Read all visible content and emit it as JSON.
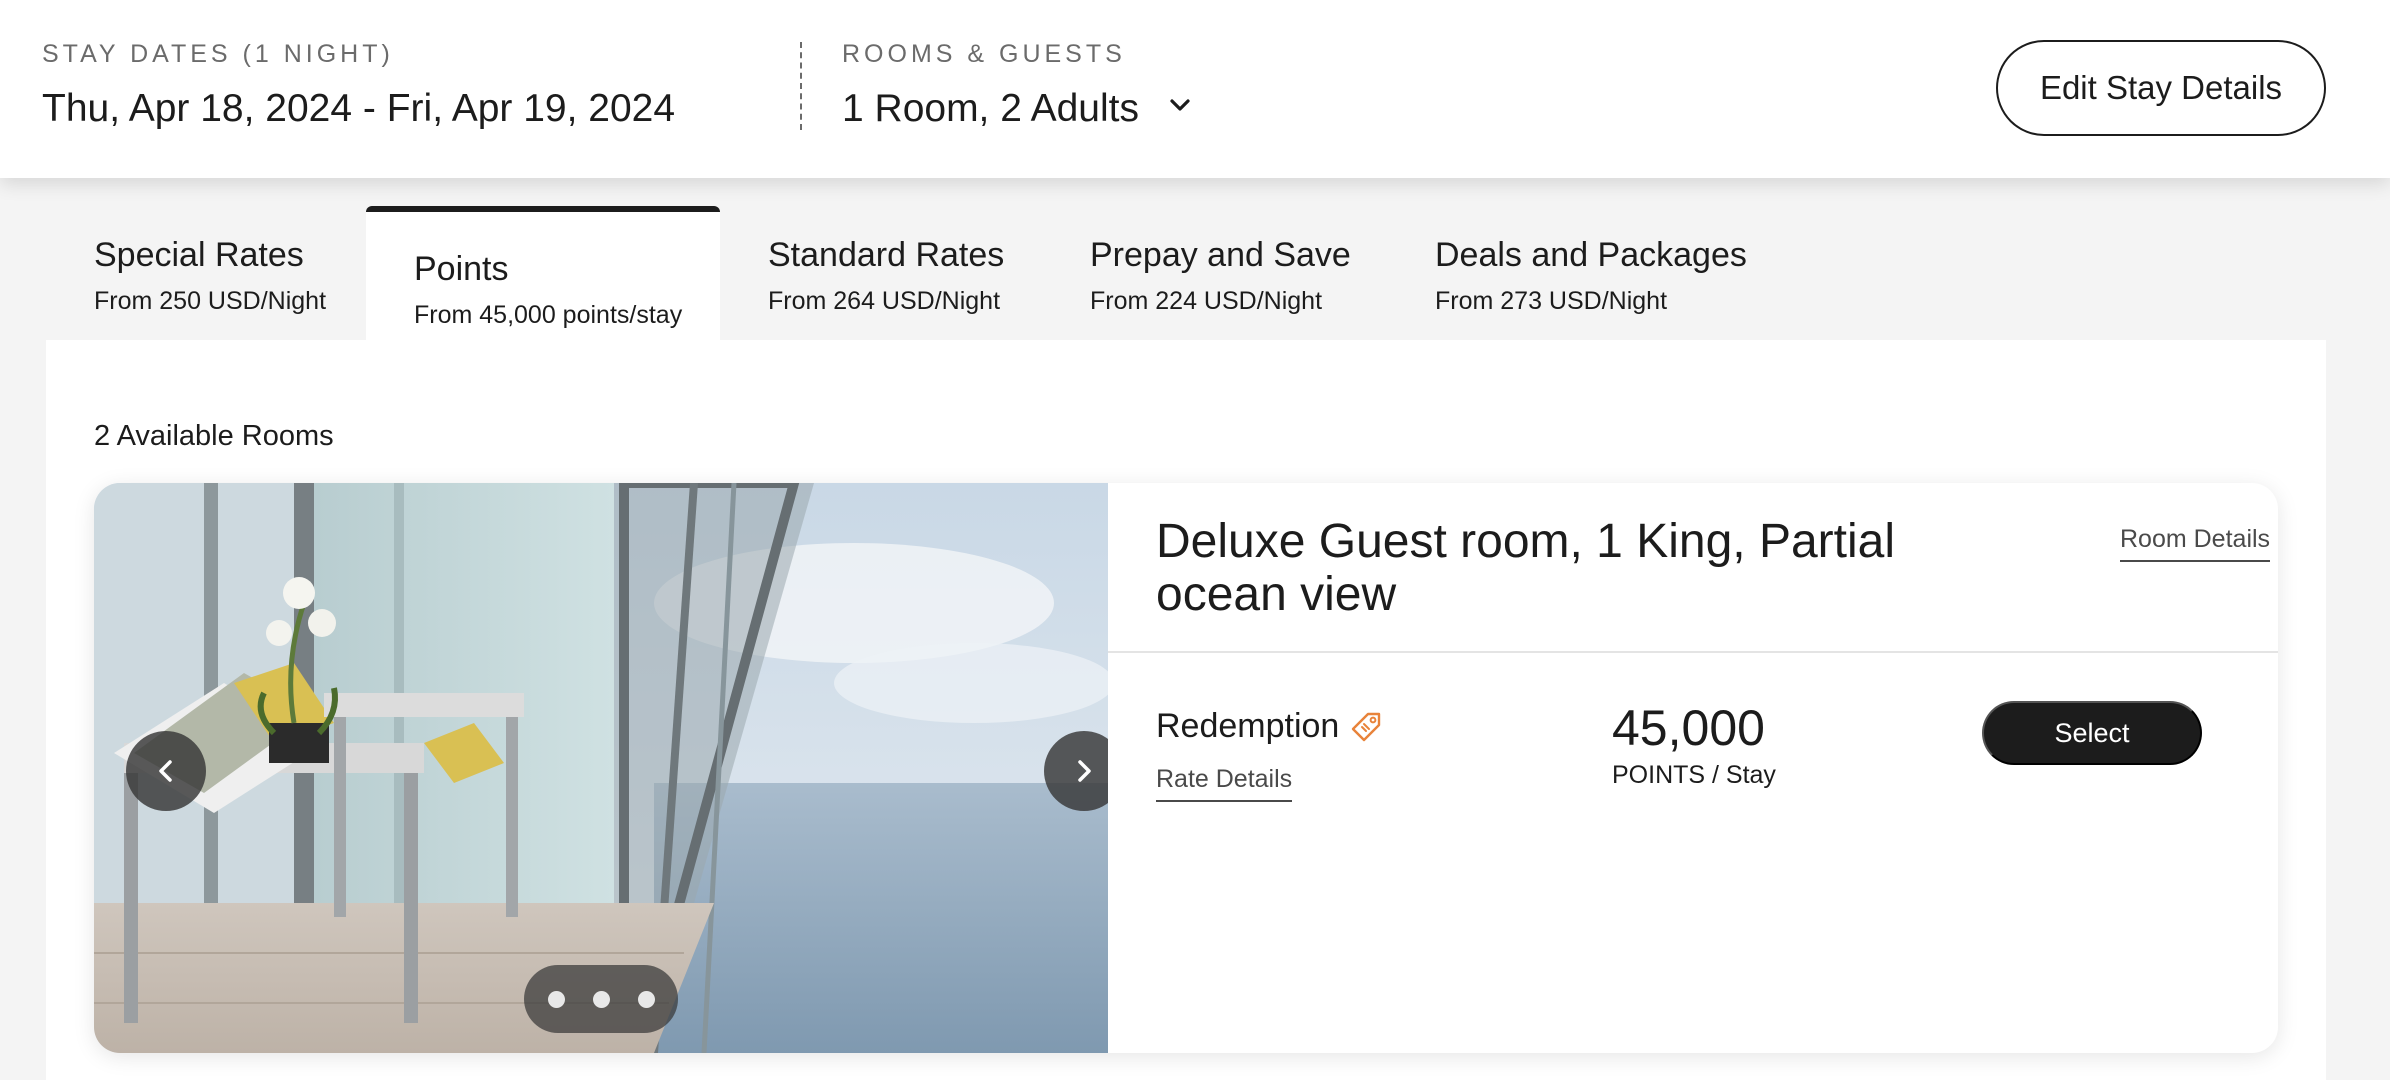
{
  "header": {
    "stay_dates_label": "STAY DATES (1 NIGHT)",
    "stay_dates_value": "Thu, Apr 18, 2024 - Fri, Apr 19, 2024",
    "rooms_guests_label": "ROOMS & GUESTS",
    "rooms_guests_value": "1 Room, 2 Adults",
    "edit_button_label": "Edit Stay Details"
  },
  "tabs": [
    {
      "title": "Special Rates",
      "subtitle": "From 250 USD/Night",
      "active": false
    },
    {
      "title": "Points",
      "subtitle": "From 45,000 points/stay",
      "active": true
    },
    {
      "title": "Standard Rates",
      "subtitle": "From 264 USD/Night",
      "active": false
    },
    {
      "title": "Prepay and Save",
      "subtitle": "From 224 USD/Night",
      "active": false
    },
    {
      "title": "Deals and Packages",
      "subtitle": "From 273 USD/Night",
      "active": false
    }
  ],
  "main": {
    "available_rooms": "2 Available Rooms",
    "room": {
      "name": "Deluxe Guest room, 1 King, Partial ocean view",
      "details_link": "Room Details",
      "carousel": {
        "slide_count": 3
      },
      "rate": {
        "name": "Redemption",
        "details_link": "Rate Details",
        "points": "45,000",
        "points_unit": "POINTS / Stay",
        "select_label": "Select"
      }
    }
  },
  "icons": {
    "dropdown": "chevron-down-icon",
    "tag": "tag-icon",
    "prev": "chevron-left-icon",
    "next": "chevron-right-icon"
  },
  "colors": {
    "accent_tag": "#e8833a",
    "primary_dark": "#1c1c1c",
    "page_bg": "#f4f4f4"
  }
}
